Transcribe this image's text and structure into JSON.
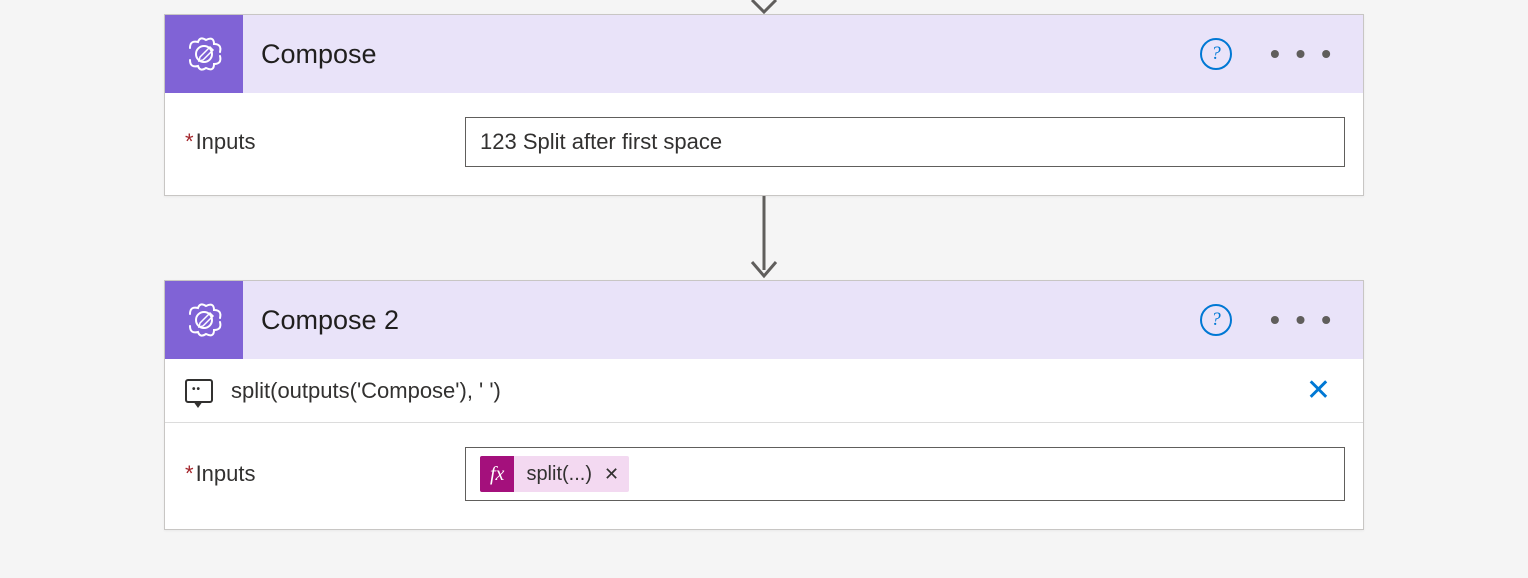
{
  "actions": [
    {
      "id": "compose1",
      "title": "Compose",
      "inputs_label": "Inputs",
      "inputs_value": "123 Split after first space"
    },
    {
      "id": "compose2",
      "title": "Compose 2",
      "inputs_label": "Inputs",
      "peek_expression": "split(outputs('Compose'), ' ')",
      "token_fx": "fx",
      "token_label": "split(...)",
      "token_remove": "✕"
    }
  ],
  "icons": {
    "help": "?",
    "more": "• • •",
    "close_x": "✕"
  }
}
